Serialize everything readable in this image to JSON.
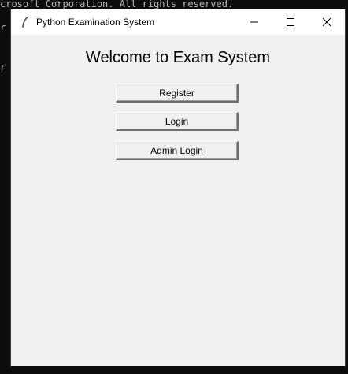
{
  "window": {
    "title": "Python Examination System",
    "controls": {
      "minimize_icon": "minimize-icon",
      "maximize_icon": "maximize-icon",
      "close_icon": "close-icon"
    }
  },
  "main": {
    "heading": "Welcome to Exam System",
    "buttons": {
      "register": "Register",
      "login": "Login",
      "admin_login": "Admin Login"
    }
  },
  "background_terminal": {
    "line1": "crosoft Corporation. All rights reserved."
  },
  "colors": {
    "window_bg": "#f0f0f0",
    "titlebar_bg": "#ffffff",
    "terminal_bg": "#0c0c0c"
  }
}
